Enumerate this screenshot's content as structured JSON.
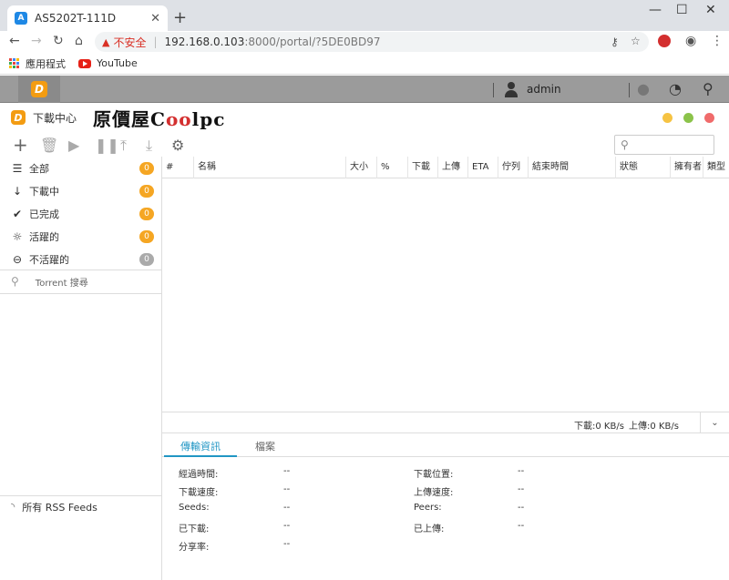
{
  "browser": {
    "tab_title": "AS5202T-111D",
    "url_warning": "不安全",
    "url_host": "192.168.0.103",
    "url_path": ":8000/portal/?5DE0BD97",
    "bookmarks": [
      {
        "label": "應用程式",
        "icon": "apps-grid-icon"
      },
      {
        "label": "YouTube",
        "icon": "youtube-icon"
      }
    ]
  },
  "adm": {
    "username": "admin"
  },
  "app": {
    "title": "下載中心",
    "watermark": "原價屋",
    "watermark_brand_pre": "C",
    "watermark_brand_oo": "oo",
    "watermark_brand_post": "lpc",
    "search_placeholder": ""
  },
  "sidebar": {
    "categories": [
      {
        "label": "全部",
        "count": "0",
        "icon": "list-icon"
      },
      {
        "label": "下載中",
        "count": "0",
        "icon": "arrow-down-icon"
      },
      {
        "label": "已完成",
        "count": "0",
        "icon": "check-icon"
      },
      {
        "label": "活躍的",
        "count": "0",
        "icon": "sun-icon"
      },
      {
        "label": "不活躍的",
        "count": "0",
        "icon": "minus-circle-icon"
      }
    ],
    "torrent_search": "Torrent 搜尋",
    "rss": "所有 RSS Feeds"
  },
  "table": {
    "columns": [
      "#",
      "名稱",
      "大小",
      "%",
      "下載",
      "上傳",
      "ETA",
      "佇列",
      "結束時間",
      "狀態",
      "擁有者",
      "類型"
    ]
  },
  "status": {
    "download": "下載:0 KB/s",
    "upload": "上傳:0 KB/s"
  },
  "detail_tabs": [
    "傳輸資訊",
    "檔案"
  ],
  "detail": {
    "left": [
      {
        "label": "經過時間:",
        "value": "--"
      },
      {
        "label": "下載速度:",
        "value": "--"
      },
      {
        "label": "Seeds:",
        "value": "--"
      },
      {
        "label": "已下載:",
        "value": "--"
      },
      {
        "label": "分享率:",
        "value": "--"
      }
    ],
    "right": [
      {
        "label": "下載位置:",
        "value": "--"
      },
      {
        "label": "上傳速度:",
        "value": "--"
      },
      {
        "label": "Peers:",
        "value": "--"
      },
      {
        "label": "已上傳:",
        "value": "--"
      }
    ]
  }
}
